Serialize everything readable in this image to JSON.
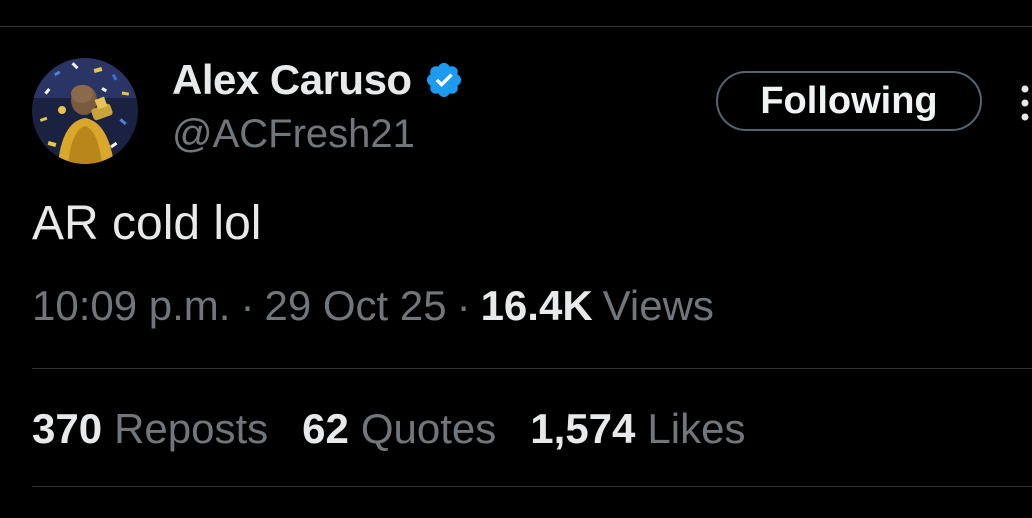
{
  "author": {
    "display_name": "Alex Caruso",
    "handle": "@ACFresh21",
    "verified": true,
    "verified_color": "#1d9bf0",
    "avatar_icon": "avatar-photo"
  },
  "follow_button": {
    "label": "Following"
  },
  "more_menu": {
    "icon": "more-vertical-icon"
  },
  "tweet": {
    "text": "AR cold lol"
  },
  "meta": {
    "time": "10:09 p.m.",
    "separator": "·",
    "date": "29 Oct 25",
    "views_count": "16.4K",
    "views_label": "Views"
  },
  "stats": {
    "reposts_count": "370",
    "reposts_label": "Reposts",
    "quotes_count": "62",
    "quotes_label": "Quotes",
    "likes_count": "1,574",
    "likes_label": "Likes"
  },
  "colors": {
    "background": "#000000",
    "primary_text": "#e7e9ea",
    "secondary_text": "#71767b",
    "divider": "#2f3336",
    "button_border": "#536471"
  }
}
